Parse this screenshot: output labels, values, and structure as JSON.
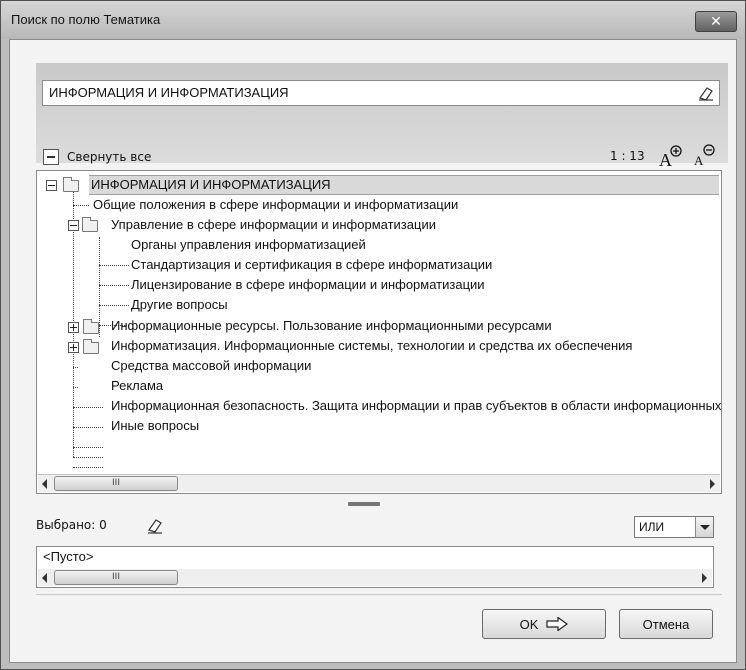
{
  "window": {
    "title": "Поиск по полю Тематика"
  },
  "search": {
    "value": "ИНФОРМАЦИЯ И ИНФОРМАТИЗАЦИЯ"
  },
  "toolbar": {
    "collapse_all_label": "Свернуть все",
    "counter": "1 : 13"
  },
  "tree": {
    "root": "ИНФОРМАЦИЯ И ИНФОРМАТИЗАЦИЯ",
    "items": [
      "Общие положения в сфере информации и информатизации",
      "Управление в сфере информации и информатизации",
      "Органы управления информатизацией",
      "Стандартизация и сертификация в сфере информатизации",
      "Лицензирование в сфере информации и информатизации",
      "Другие вопросы",
      "Информационные ресурсы. Пользование информационными ресурсами",
      "Информатизация. Информационные системы, технологии и средства их обеспечения",
      "Средства массовой информации",
      "Реклама",
      "Информационная безопасность. Защита информации и прав субъектов в области информационных процессов",
      "Иные вопросы"
    ],
    "scroll_thumb": "III"
  },
  "selection": {
    "count_label": "Выбрано: 0",
    "logic_value": "ИЛИ",
    "empty_text": "<Пусто>",
    "scroll_thumb": "III"
  },
  "buttons": {
    "ok": "OK",
    "cancel": "Отмена"
  }
}
